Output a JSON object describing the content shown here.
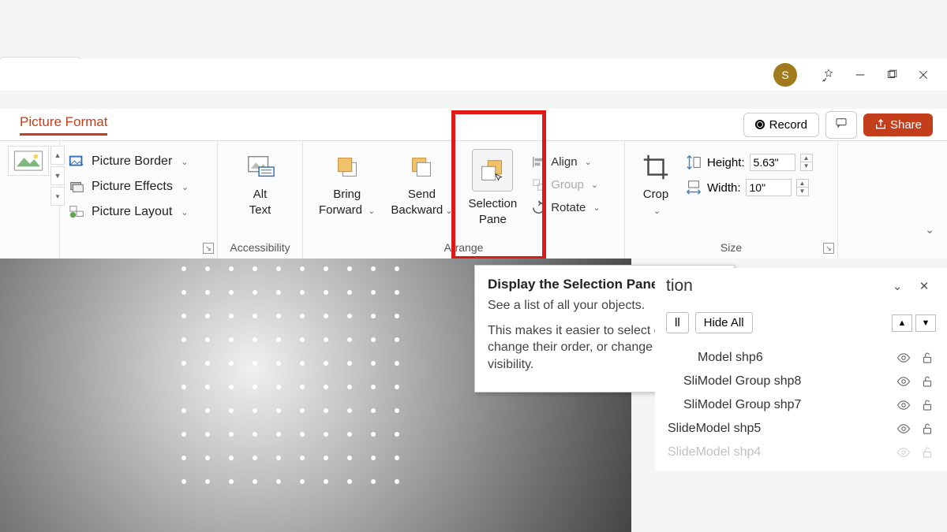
{
  "titlebar": {
    "avatar_letter": "S"
  },
  "tab": {
    "label": "Picture Format"
  },
  "right_controls": {
    "record_label": "Record",
    "share_label": "Share"
  },
  "ribbon": {
    "format_options": {
      "border": "Picture Border",
      "effects": "Picture Effects",
      "layout": "Picture Layout"
    },
    "accessibility": {
      "alt_text_top": "Alt",
      "alt_text_bottom": "Text",
      "group": "Accessibility"
    },
    "arrange": {
      "bring_forward_top": "Bring",
      "bring_forward_bottom": "Forward",
      "send_backward_top": "Send",
      "send_backward_bottom": "Backward",
      "selection_pane_top": "Selection",
      "selection_pane_bottom": "Pane",
      "align": "Align",
      "group_btn": "Group",
      "rotate": "Rotate",
      "group_label": "Arrange"
    },
    "size": {
      "crop": "Crop",
      "height_label": "Height:",
      "height_value": "5.63\"",
      "width_label": "Width:",
      "width_value": "10\"",
      "group_label": "Size"
    }
  },
  "tooltip": {
    "title": "Display the Selection Pane",
    "line1": "See a list of all your objects.",
    "line2": "This makes it easier to select objects, change their order, or change their visibility."
  },
  "selection_pane": {
    "title_suffix": "tion",
    "hide_all": "Hide All",
    "all_suffix": "ll",
    "items": [
      {
        "label": "Model shp6",
        "indent": 2
      },
      {
        "label": "SliModel Group shp8",
        "indent": 1
      },
      {
        "label": "SliModel Group shp7",
        "indent": 1
      },
      {
        "label": "SlideModel shp5",
        "indent": 0
      },
      {
        "label": "SlideModel shp4",
        "indent": 0,
        "cut": true
      }
    ]
  }
}
